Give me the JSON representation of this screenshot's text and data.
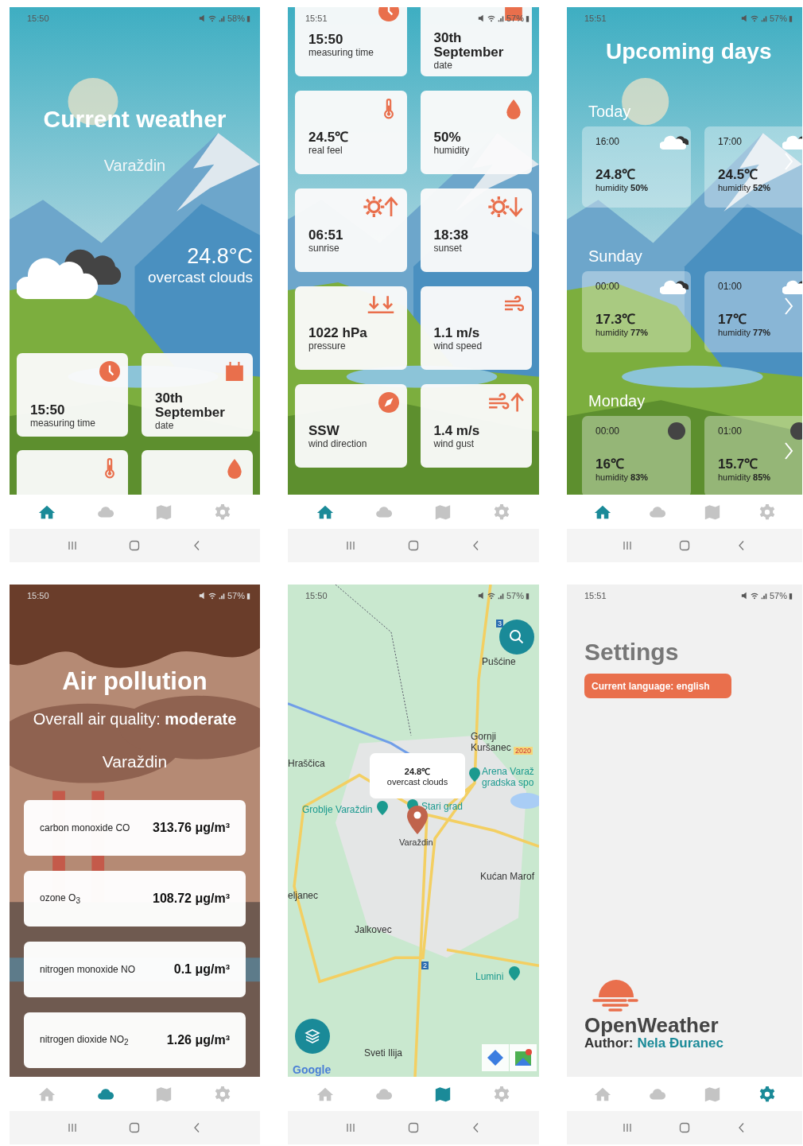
{
  "screens": [
    {
      "kind": "current",
      "status": {
        "time": "15:50",
        "battery": "58%"
      },
      "title": "Current weather",
      "city": "Varaždin",
      "temperature": "24.8°C",
      "description": "overcast clouds",
      "cards": [
        {
          "kind": "clock",
          "value": "15:50",
          "label": "measuring time"
        },
        {
          "kind": "calendar",
          "value": "30th September",
          "label": "date"
        },
        {
          "kind": "thermometer"
        },
        {
          "kind": "drop"
        }
      ],
      "nav": [
        {
          "kind": "home",
          "selected": true
        },
        {
          "kind": "cloud",
          "selected": false
        },
        {
          "kind": "map",
          "selected": false
        },
        {
          "kind": "gear",
          "selected": false
        }
      ]
    },
    {
      "kind": "details",
      "status": {
        "time": "15:51",
        "battery": "57%"
      },
      "cards": [
        {
          "kind": "clock",
          "value": "15:50",
          "label": "measuring time"
        },
        {
          "kind": "calendar",
          "value": "30th September",
          "label": "date"
        },
        {
          "kind": "thermometer",
          "value": "24.5℃",
          "label": "real feel"
        },
        {
          "kind": "drop",
          "value": "50%",
          "label": "humidity"
        },
        {
          "kind": "sunrise",
          "value": "06:51",
          "label": "sunrise"
        },
        {
          "kind": "sunset",
          "value": "18:38",
          "label": "sunset"
        },
        {
          "kind": "pressure",
          "value": "1022 hPa",
          "label": "pressure"
        },
        {
          "kind": "wind",
          "value": "1.1 m/s",
          "label": "wind speed"
        },
        {
          "kind": "compass",
          "value": "SSW",
          "label": "wind direction"
        },
        {
          "kind": "gust",
          "value": "1.4 m/s",
          "label": "wind gust"
        }
      ],
      "nav": [
        {
          "kind": "home",
          "selected": true
        },
        {
          "kind": "cloud",
          "selected": false
        },
        {
          "kind": "map",
          "selected": false
        },
        {
          "kind": "gear",
          "selected": false
        }
      ]
    },
    {
      "kind": "forecast",
      "status": {
        "time": "15:51",
        "battery": "57%"
      },
      "title": "Upcoming days",
      "days": [
        {
          "name": "Today",
          "hours": [
            {
              "time": "16:00",
              "kind": "clouds",
              "temperature": "24.8℃",
              "humidity": "humidity **50%**"
            },
            {
              "time": "17:00",
              "kind": "clouds",
              "temperature": "24.5℃",
              "humidity": "humidity **52%**"
            }
          ]
        },
        {
          "name": "Sunday",
          "hours": [
            {
              "time": "00:00",
              "kind": "clouds",
              "temperature": "17.3℃",
              "humidity": "humidity **77%**"
            },
            {
              "time": "01:00",
              "kind": "clouds",
              "temperature": "17℃",
              "humidity": "humidity **77%**"
            }
          ]
        },
        {
          "name": "Monday",
          "hours": [
            {
              "time": "00:00",
              "kind": "dark",
              "temperature": "16℃",
              "humidity": "humidity **83%**"
            },
            {
              "time": "01:00",
              "kind": "dark",
              "temperature": "15.7℃",
              "humidity": "humidity **85%**"
            }
          ]
        }
      ],
      "nav": [
        {
          "kind": "home",
          "selected": true
        },
        {
          "kind": "cloud",
          "selected": false
        },
        {
          "kind": "map",
          "selected": false
        },
        {
          "kind": "gear",
          "selected": false
        }
      ]
    },
    {
      "kind": "air",
      "status": {
        "time": "15:50",
        "battery": "57%"
      },
      "title": "Air pollution",
      "quality": "Overall air quality: **moderate**",
      "city": "Varaždin",
      "pollutants": [
        {
          "name": "carbon monoxide CO",
          "value": "313.76 μg/m³"
        },
        {
          "name": "ozone O$_{3}$",
          "value": "108.72 μg/m³"
        },
        {
          "name": "nitrogen monoxide NO",
          "value": "0.1 μg/m³"
        },
        {
          "name": "nitrogen dioxide NO$_{2}$",
          "value": "1.26 μg/m³"
        }
      ],
      "nav": [
        {
          "kind": "home",
          "selected": false
        },
        {
          "kind": "cloud",
          "selected": true
        },
        {
          "kind": "map",
          "selected": false
        },
        {
          "kind": "gear",
          "selected": false
        }
      ]
    },
    {
      "kind": "map",
      "status": {
        "time": "15:50",
        "battery": "57%"
      },
      "popup": {
        "temperature": "24.8℃",
        "description": "overcast clouds"
      },
      "marker_label": "Varaždin",
      "places": [
        {
          "kind": "place",
          "text": "Pušćine"
        },
        {
          "kind": "place",
          "text": "Gornji\nKuršanec"
        },
        {
          "kind": "place",
          "text": "Hraščica"
        },
        {
          "kind": "poi",
          "text": "Arena Varaž\ngradska spo"
        },
        {
          "kind": "poi",
          "text": "Groblje Varaždin"
        },
        {
          "kind": "poi",
          "text": "Stari grad"
        },
        {
          "kind": "place",
          "text": "Kućan Marof"
        },
        {
          "kind": "place",
          "text": "eljanec"
        },
        {
          "kind": "place",
          "text": "Jalkovec"
        },
        {
          "kind": "poi",
          "text": "Lumini"
        },
        {
          "kind": "place",
          "text": "Sveti Ilija"
        }
      ],
      "road_numbers": [
        "3",
        "2020",
        "2"
      ],
      "attribution": "Google",
      "nav": [
        {
          "kind": "home",
          "selected": false
        },
        {
          "kind": "cloud",
          "selected": false
        },
        {
          "kind": "map",
          "selected": true
        },
        {
          "kind": "gear",
          "selected": false
        }
      ]
    },
    {
      "kind": "settings",
      "status": {
        "time": "15:51",
        "battery": "57%"
      },
      "title": "Settings",
      "language_button": "Current language: english",
      "logo": "OpenWeather",
      "author_label": "Author:",
      "author_name": "Nela Đuranec",
      "nav": [
        {
          "kind": "home",
          "selected": false
        },
        {
          "kind": "cloud",
          "selected": false
        },
        {
          "kind": "map",
          "selected": false
        },
        {
          "kind": "gear",
          "selected": true
        }
      ]
    }
  ]
}
